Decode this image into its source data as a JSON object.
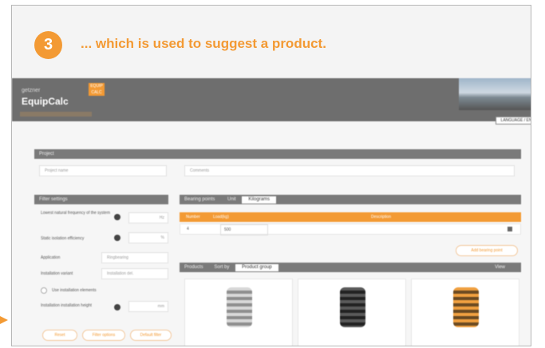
{
  "callout": {
    "step": "3",
    "text": "... which is used to suggest a product."
  },
  "app": {
    "brand_small": "getzner",
    "brand_name": "EquipCalc",
    "badge": "EQUIP CALC",
    "language_button": "LANGUAGE / EN",
    "project": {
      "title": "Project",
      "name_placeholder": "Project name",
      "comment_placeholder": "Comments"
    },
    "filter": {
      "title": "Filter settings",
      "fields": [
        {
          "label": "Lowest natural frequency of the system",
          "value": "Hz"
        },
        {
          "label": "Static isolation efficiency",
          "value": "%"
        },
        {
          "label": "Application",
          "value": "Ringbearing"
        },
        {
          "label": "Installation variant",
          "value": "Installation del."
        },
        {
          "label": "Use installation elements",
          "value": ""
        },
        {
          "label": "Installation installation height",
          "value": "mm"
        }
      ],
      "buttons": [
        "Reset",
        "Filter options",
        "Default filter"
      ]
    },
    "bearing": {
      "title": "Bearing points",
      "unit_label": "Unit",
      "unit_value": "Kilograms",
      "columns": [
        "Number",
        "Load(kg)",
        "Description"
      ],
      "row": {
        "number": "4",
        "load": "500",
        "desc": ""
      },
      "add_button": "Add bearing point"
    },
    "products": {
      "title": "Products",
      "sort_label": "Sort by",
      "sort_value": "Product group",
      "view": "View"
    }
  }
}
